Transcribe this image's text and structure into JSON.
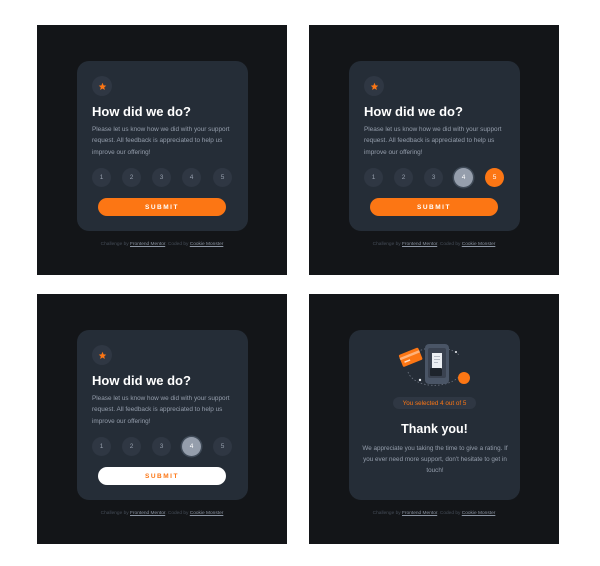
{
  "colors": {
    "page_bg": "#131518",
    "card_bg": "#252D37",
    "accent_orange": "#FC7614",
    "muted_text": "#959EAC",
    "circle_bg": "#2F3743",
    "white": "#FFFFFF"
  },
  "icons": {
    "star": "star-icon",
    "illustration": "thank-you-illustration"
  },
  "rating_card": {
    "title": "How did we do?",
    "description": "Please let us know how we did with your support request. All feedback is appreciated to help us improve our offering!",
    "ratings": [
      "1",
      "2",
      "3",
      "4",
      "5"
    ],
    "submit_label": "SUBMIT"
  },
  "thank_you_card": {
    "selected_text": "You selected 4 out of 5",
    "title": "Thank you!",
    "description": "We appreciate you taking the time to give a rating. If you ever need more support, don't hesitate to get in touch!"
  },
  "attribution": {
    "challenge_prefix": "Challenge by",
    "challenge_link": "Frontend Mentor",
    "coded_prefix": ". Coded by",
    "coded_link": "Cookie Monster"
  },
  "states": [
    {
      "name": "default",
      "hovered_rating": null,
      "selected_rating": null,
      "submit_style": "orange"
    },
    {
      "name": "hover-rating",
      "hovered_rating": 5,
      "selected_rating": 4,
      "submit_style": "orange"
    },
    {
      "name": "hover-submit",
      "hovered_rating": null,
      "selected_rating": 4,
      "submit_style": "white"
    },
    {
      "name": "thank-you",
      "selected_rating": 4
    }
  ]
}
